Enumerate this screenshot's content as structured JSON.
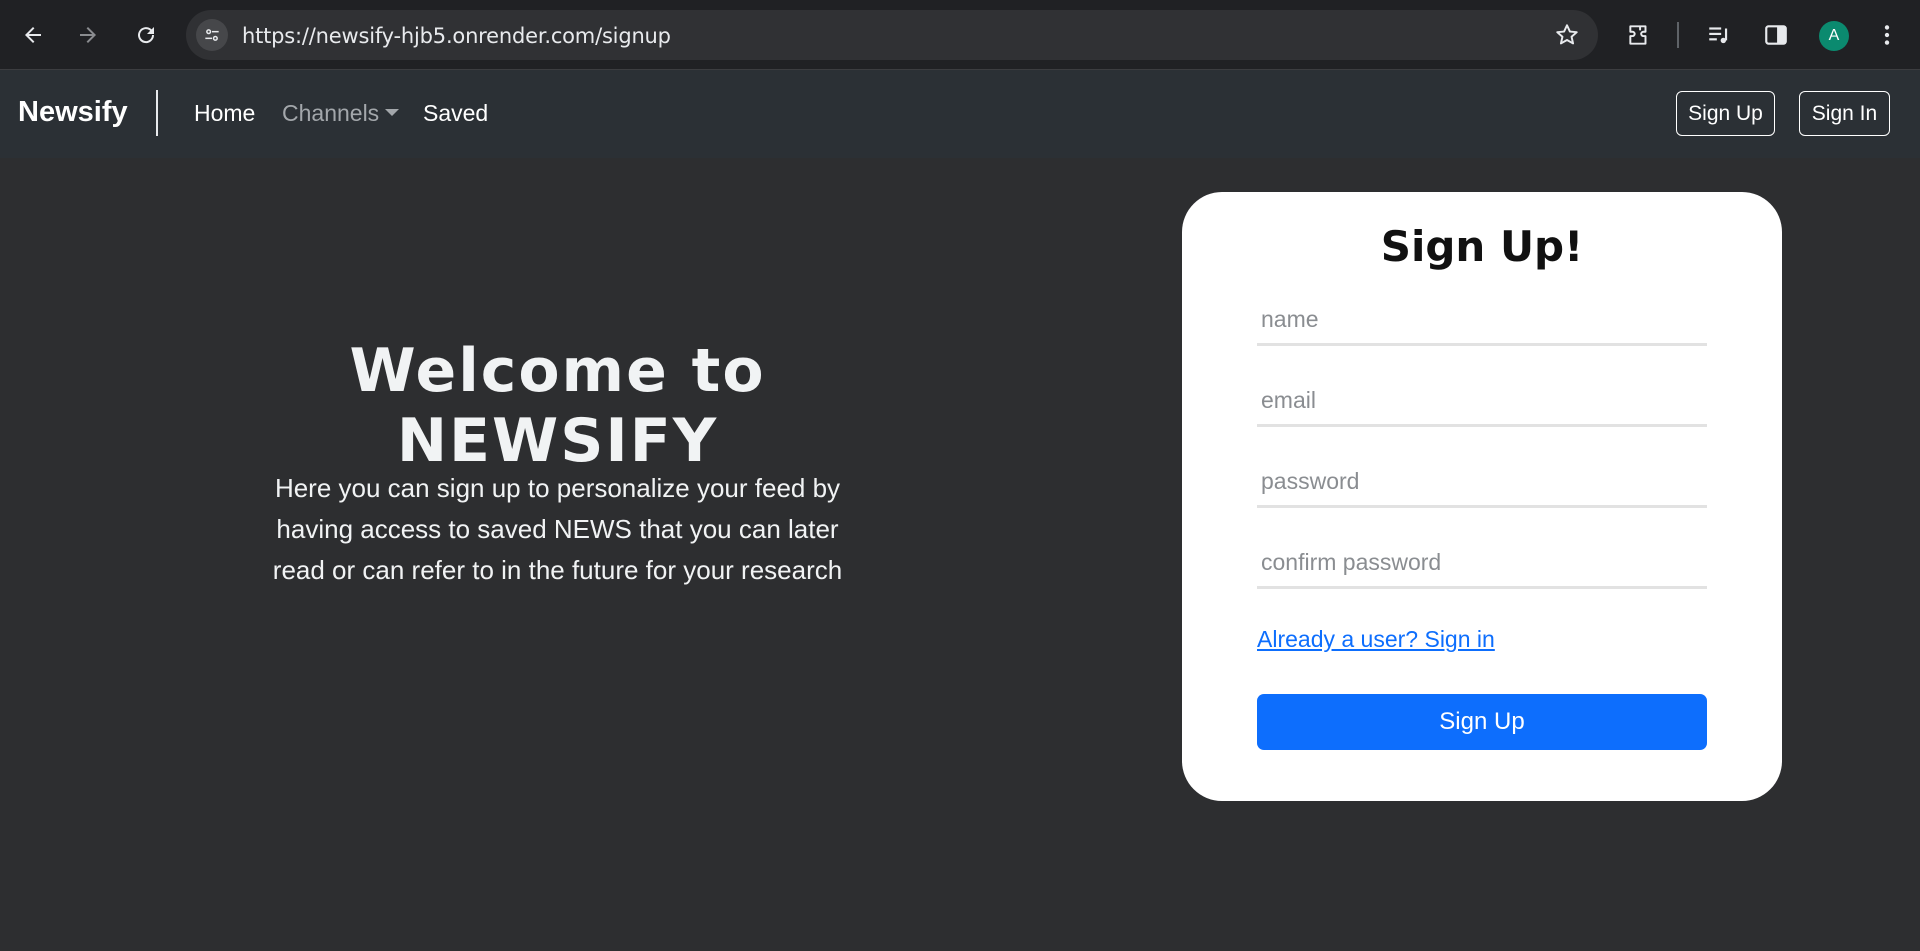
{
  "browser": {
    "url": "https://newsify-hjb5.onrender.com/signup",
    "profile_initial": "A",
    "icons": [
      "back-icon",
      "forward-icon",
      "reload-icon",
      "site-info-icon",
      "star-icon",
      "extensions-icon",
      "media-control-icon",
      "side-panel-icon",
      "menu-icon"
    ]
  },
  "navbar": {
    "brand": "Newsify",
    "links": [
      {
        "label": "Home"
      },
      {
        "label": "Channels"
      },
      {
        "label": "Saved"
      }
    ],
    "sign_up_label": "Sign Up",
    "sign_in_label": "Sign In"
  },
  "hero": {
    "title": "Welcome to NEWSIFY",
    "text_lines": [
      "Here you can sign up to personalize your feed by",
      "having access to saved NEWS that you can later",
      "read or can refer to in the future for your research"
    ]
  },
  "signup_form": {
    "title": "Sign Up!",
    "fields": {
      "name": {
        "placeholder": "name",
        "value": ""
      },
      "email": {
        "placeholder": "email",
        "value": ""
      },
      "password": {
        "placeholder": "password",
        "value": ""
      },
      "confirm_password": {
        "placeholder": "confirm password",
        "value": ""
      }
    },
    "signin_link": "Already a user? Sign in",
    "submit_label": "Sign Up"
  },
  "colors": {
    "page_bg": "#2d2e30",
    "navbar_bg": "#2b3035",
    "primary": "#0d6efd",
    "card_bg": "#ffffff"
  }
}
